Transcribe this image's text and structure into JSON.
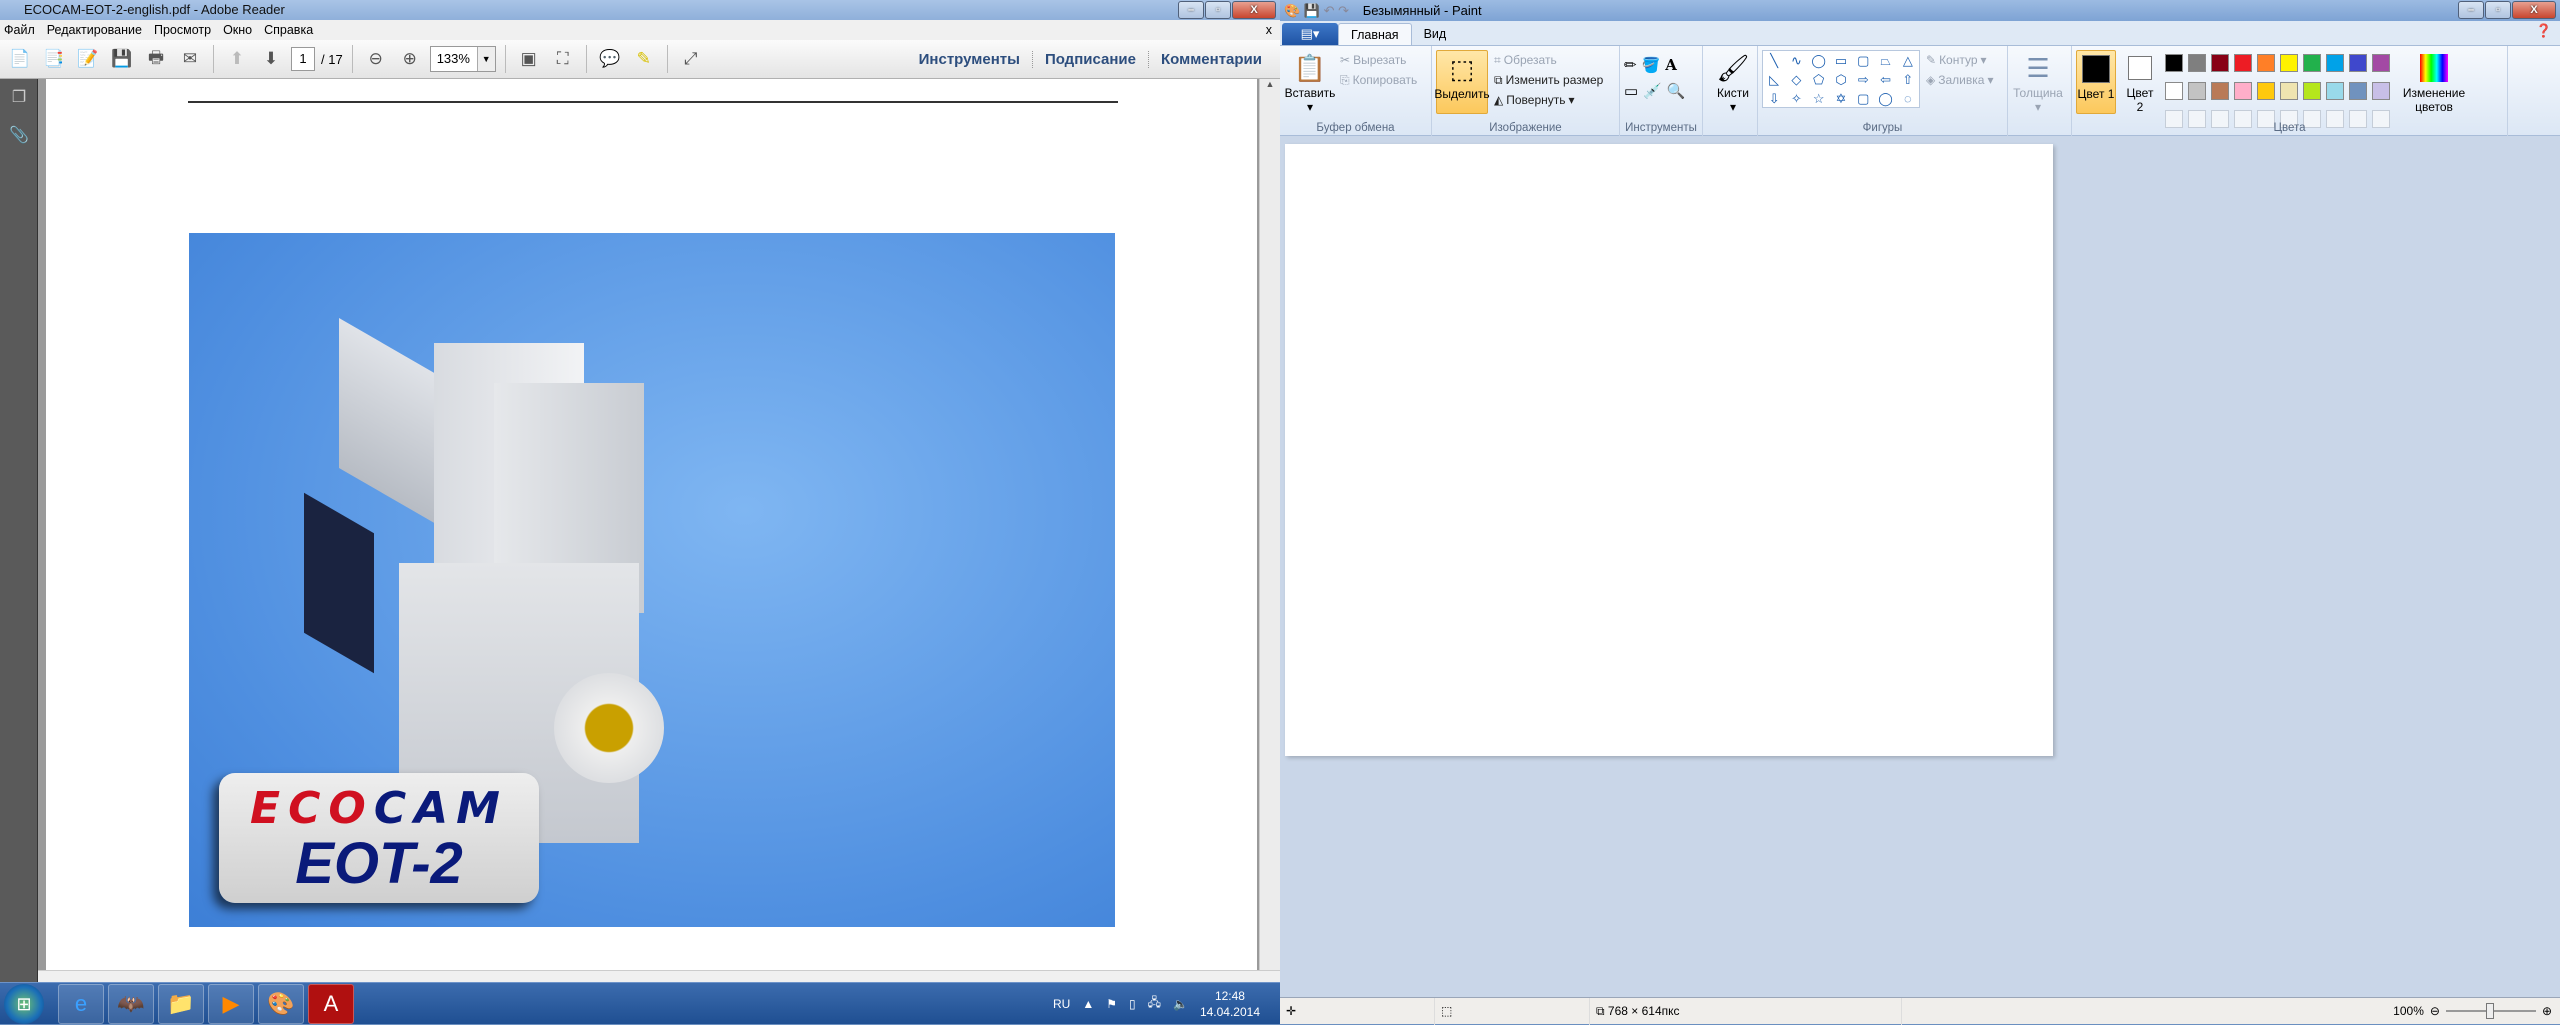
{
  "adobe": {
    "title": "ECOCAM-EOT-2-english.pdf - Adobe Reader",
    "menu": [
      "Файл",
      "Редактирование",
      "Просмотр",
      "Окно",
      "Справка"
    ],
    "page_current": "1",
    "page_total": "/ 17",
    "zoom": "133%",
    "right_links": [
      "Инструменты",
      "Подписание",
      "Комментарии"
    ],
    "logo": {
      "line1_a": "ECO",
      "line1_b": "CAM",
      "line2": "EOT-2"
    }
  },
  "taskbar": {
    "lang": "RU",
    "time": "12:48",
    "date": "14.04.2014",
    "apps": [
      "internet-explorer",
      "batman-app",
      "file-explorer",
      "media-player",
      "paint",
      "adobe-reader"
    ]
  },
  "paint": {
    "title": "Безымянный - Paint",
    "tabs": [
      "Главная",
      "Вид"
    ],
    "clipboard": {
      "paste": "Вставить",
      "cut": "Вырезать",
      "copy": "Копировать",
      "label": "Буфер обмена"
    },
    "image": {
      "select": "Выделить",
      "crop": "Обрезать",
      "resize": "Изменить размер",
      "rotate": "Повернуть",
      "label": "Изображение"
    },
    "tools": {
      "label": "Инструменты"
    },
    "brushes": "Кисти",
    "shapes": {
      "outline": "Контур",
      "fill": "Заливка",
      "label": "Фигуры"
    },
    "size": "Толщина",
    "colors": {
      "color1": "Цвет 1",
      "color2": "Цвет 2",
      "edit": "Изменение цветов",
      "label": "Цвета",
      "palette": [
        "#000000",
        "#7f7f7f",
        "#880015",
        "#ed1c24",
        "#ff7f27",
        "#fff200",
        "#22b14c",
        "#00a2e8",
        "#3f48cc",
        "#a349a4",
        "#ffffff",
        "#c3c3c3",
        "#b97a57",
        "#ffaec9",
        "#ffc90e",
        "#efe4b0",
        "#b5e61d",
        "#99d9ea",
        "#7092be",
        "#c8bfe7"
      ]
    },
    "status": {
      "size": "768 × 614пкс",
      "zoom": "100%"
    }
  }
}
